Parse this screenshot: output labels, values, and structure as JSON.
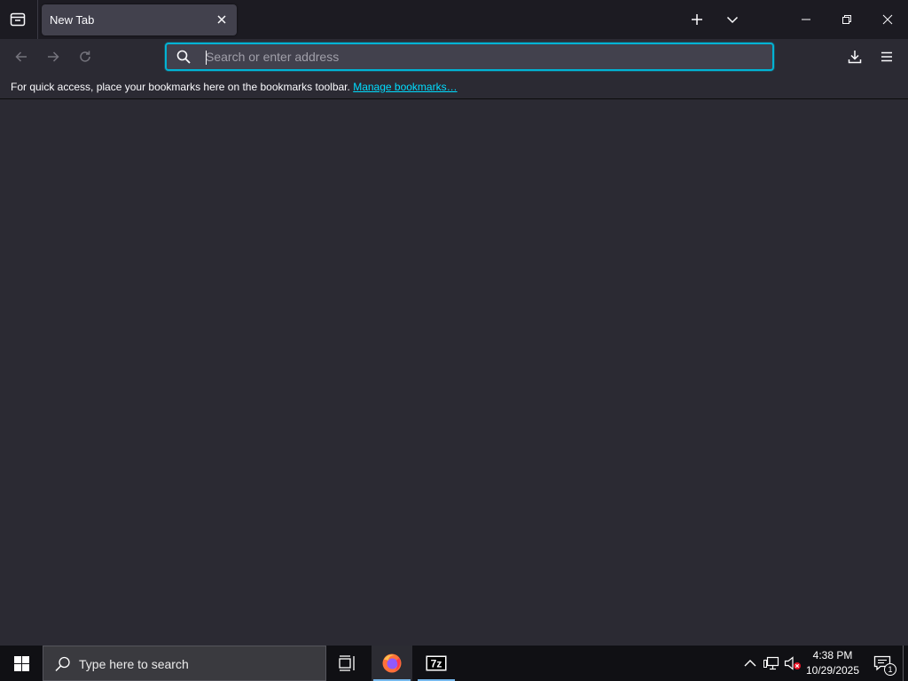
{
  "tabs": [
    {
      "title": "New Tab",
      "active": true
    }
  ],
  "urlbar": {
    "placeholder": "Search or enter address",
    "value": ""
  },
  "bookmarks_bar": {
    "message": "For quick access, place your bookmarks here on the bookmarks toolbar.",
    "link_label": "Manage bookmarks…"
  },
  "taskbar": {
    "search_placeholder": "Type here to search",
    "clock": {
      "time": "4:38 PM",
      "date": "10/29/2025"
    },
    "notification_count": "1",
    "apps": [
      {
        "name": "firefox",
        "icon": "firefox-icon",
        "active": true
      },
      {
        "name": "7-Zip",
        "icon": "7zip-icon",
        "label": "7z",
        "active": false
      }
    ]
  },
  "icons": {
    "tab_list": "firefox-view-icon",
    "tab_close": "close-icon",
    "new_tab": "plus-icon",
    "list_all_tabs": "chevron-down-icon",
    "minimize": "minimize-icon",
    "restore": "restore-icon",
    "close_window": "close-icon",
    "back": "arrow-left-icon",
    "forward": "arrow-right-icon",
    "reload": "reload-icon",
    "search": "search-icon",
    "downloads": "download-icon",
    "menu": "hamburger-menu-icon",
    "start": "windows-logo-icon",
    "task_view": "task-view-icon",
    "tray_chevron": "chevron-up-icon",
    "network": "network-icon",
    "volume": "volume-muted-icon",
    "notifications": "notification-icon"
  },
  "colors": {
    "accent": "#00b3d4",
    "link": "#00ddff",
    "toolbar": "#2b2a33",
    "tabstrip": "#1c1b22",
    "taskbar": "#101014",
    "volume_error": "#e81123"
  }
}
